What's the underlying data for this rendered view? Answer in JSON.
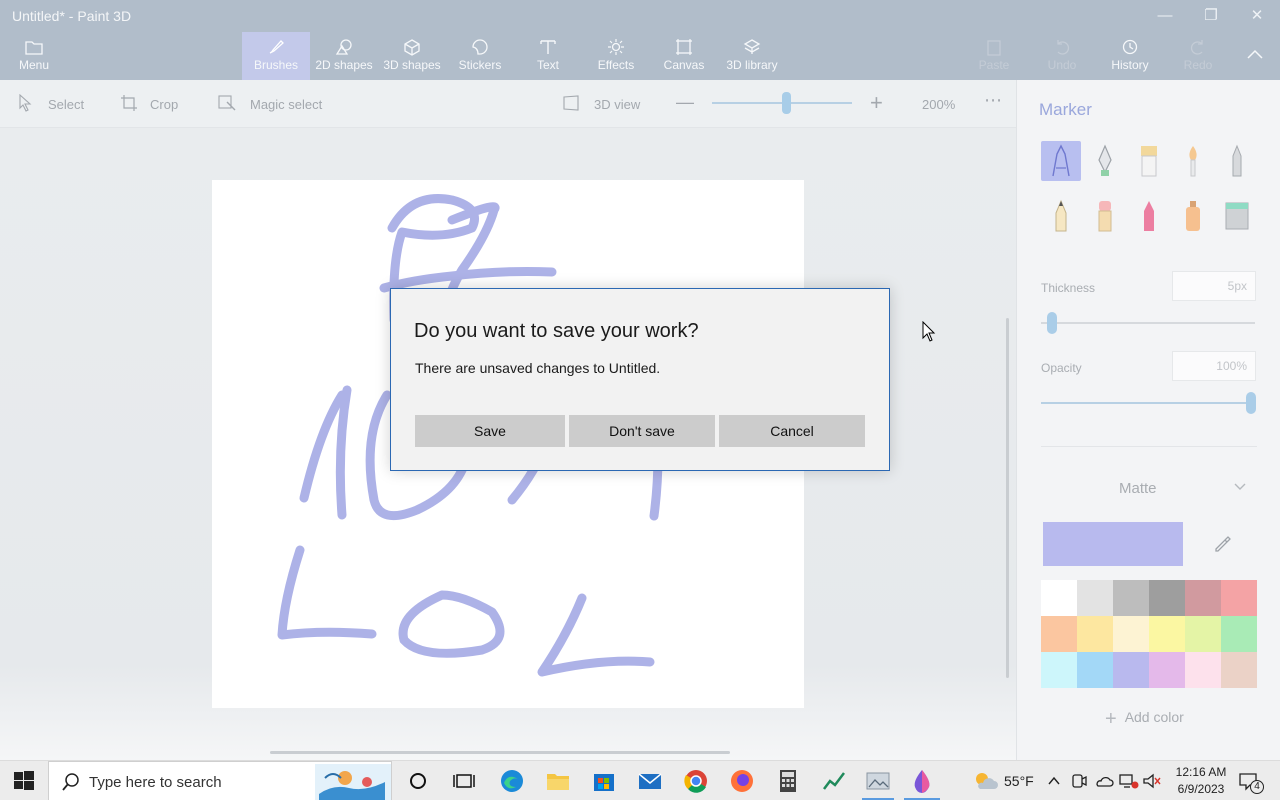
{
  "window": {
    "title": "Untitled* - Paint 3D"
  },
  "ribbon": {
    "menu_label": "Menu",
    "tabs": [
      {
        "label": "Brushes"
      },
      {
        "label": "2D shapes"
      },
      {
        "label": "3D shapes"
      },
      {
        "label": "Stickers"
      },
      {
        "label": "Text"
      },
      {
        "label": "Effects"
      },
      {
        "label": "Canvas"
      },
      {
        "label": "3D library"
      }
    ],
    "paste_label": "Paste",
    "undo_label": "Undo",
    "history_label": "History",
    "redo_label": "Redo"
  },
  "toolbar": {
    "select_label": "Select",
    "crop_label": "Crop",
    "magic_select_label": "Magic select",
    "view3d_label": "3D view",
    "zoom_label": "200%",
    "zoom_level": 0.5
  },
  "panel": {
    "heading": "Marker",
    "thickness_label": "Thickness",
    "thickness_value": "5px",
    "opacity_label": "Opacity",
    "opacity_value": "100%",
    "finish_label": "Matte",
    "current_color": "#b8baee",
    "add_color_label": "Add color",
    "palette": [
      "#ffffff",
      "#e3e3e3",
      "#bdbdbd",
      "#9e9e9e",
      "#d19a9f",
      "#f4a3a5",
      "#fbc6a0",
      "#fde7a0",
      "#fdf3d3",
      "#fbf7a2",
      "#e4f4a6",
      "#a9ebb6",
      "#cdf6fb",
      "#a3d8f7",
      "#b9b9ee",
      "#e4b9ea",
      "#fde1ec",
      "#ebd2c7"
    ]
  },
  "dialog": {
    "title": "Do you want to save your work?",
    "message": "There are unsaved changes to Untitled.",
    "save_label": "Save",
    "dont_save_label": "Don't save",
    "cancel_label": "Cancel"
  },
  "taskbar": {
    "search_placeholder": "Type here to search",
    "temperature": "55°F",
    "time": "12:16 AM",
    "date": "6/9/2023",
    "notification_count": "4"
  },
  "colors": {
    "accent": "#2b68b3",
    "stroke": "#a9aee6"
  }
}
